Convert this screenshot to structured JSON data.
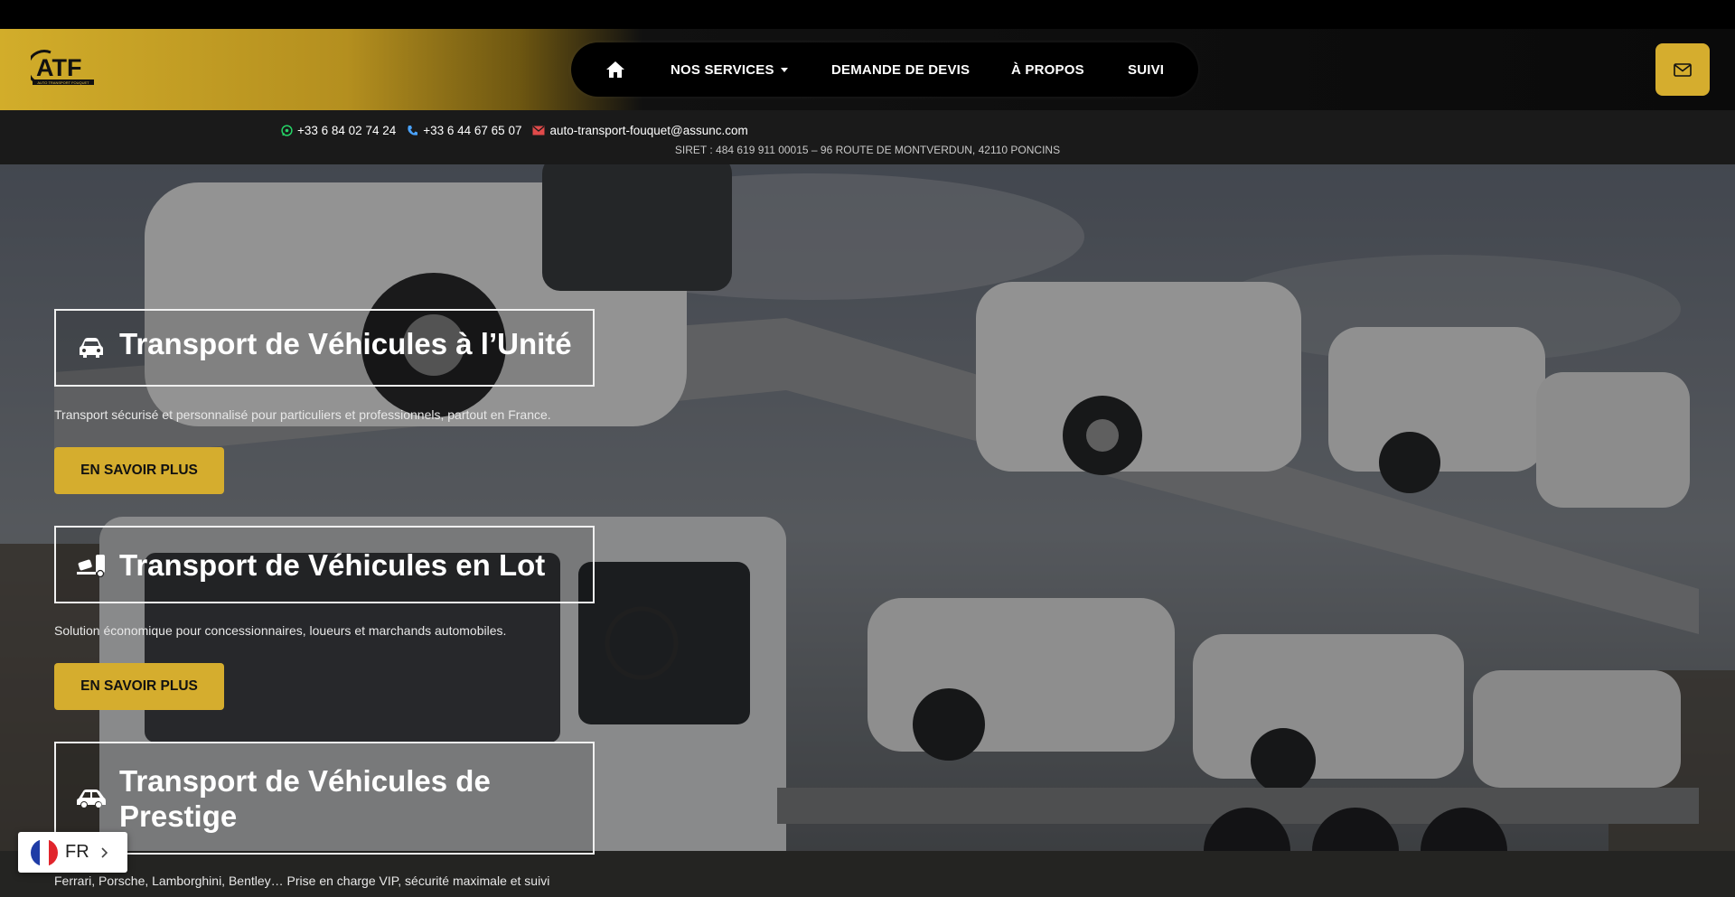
{
  "nav": {
    "logo_text": "ATF",
    "logo_subtext": "AUTO TRANSPORT FOUQUET",
    "items": [
      {
        "label": "NOS SERVICES"
      },
      {
        "label": "DEMANDE DE DEVIS"
      },
      {
        "label": "À PROPOS"
      },
      {
        "label": "SUIVI"
      }
    ]
  },
  "contact": {
    "whatsapp": "+33 6 84 02 74 24",
    "phone": "+33 6 44 67 65 07",
    "email": "auto-transport-fouquet@assunc.com",
    "siret": "SIRET : 484 619 911 00015 – 96 ROUTE DE MONTVERDUN, 42110 PONCINS"
  },
  "services": [
    {
      "title": "Transport de Véhicules à l’Unité",
      "description": "Transport sécurisé et personnalisé pour particuliers et professionnels, partout en France.",
      "button": "EN SAVOIR PLUS",
      "icon": "car-icon"
    },
    {
      "title": "Transport de Véhicules en Lot",
      "description": "Solution économique pour concessionnaires, loueurs et marchands automobiles.",
      "button": "EN SAVOIR PLUS",
      "icon": "truck-ramp-icon"
    },
    {
      "title": "Transport de Véhicules de Prestige",
      "description": "Ferrari, Porsche, Lamborghini, Bentley… Prise en charge VIP, sécurité maximale et suivi",
      "icon": "car-side-icon"
    }
  ],
  "language": {
    "label": "FR"
  },
  "colors": {
    "accent": "#d5ad2e",
    "dark": "#0a0a0a",
    "whatsapp": "#25d366",
    "phone": "#4aa3ff",
    "email": "#e04a4a"
  }
}
